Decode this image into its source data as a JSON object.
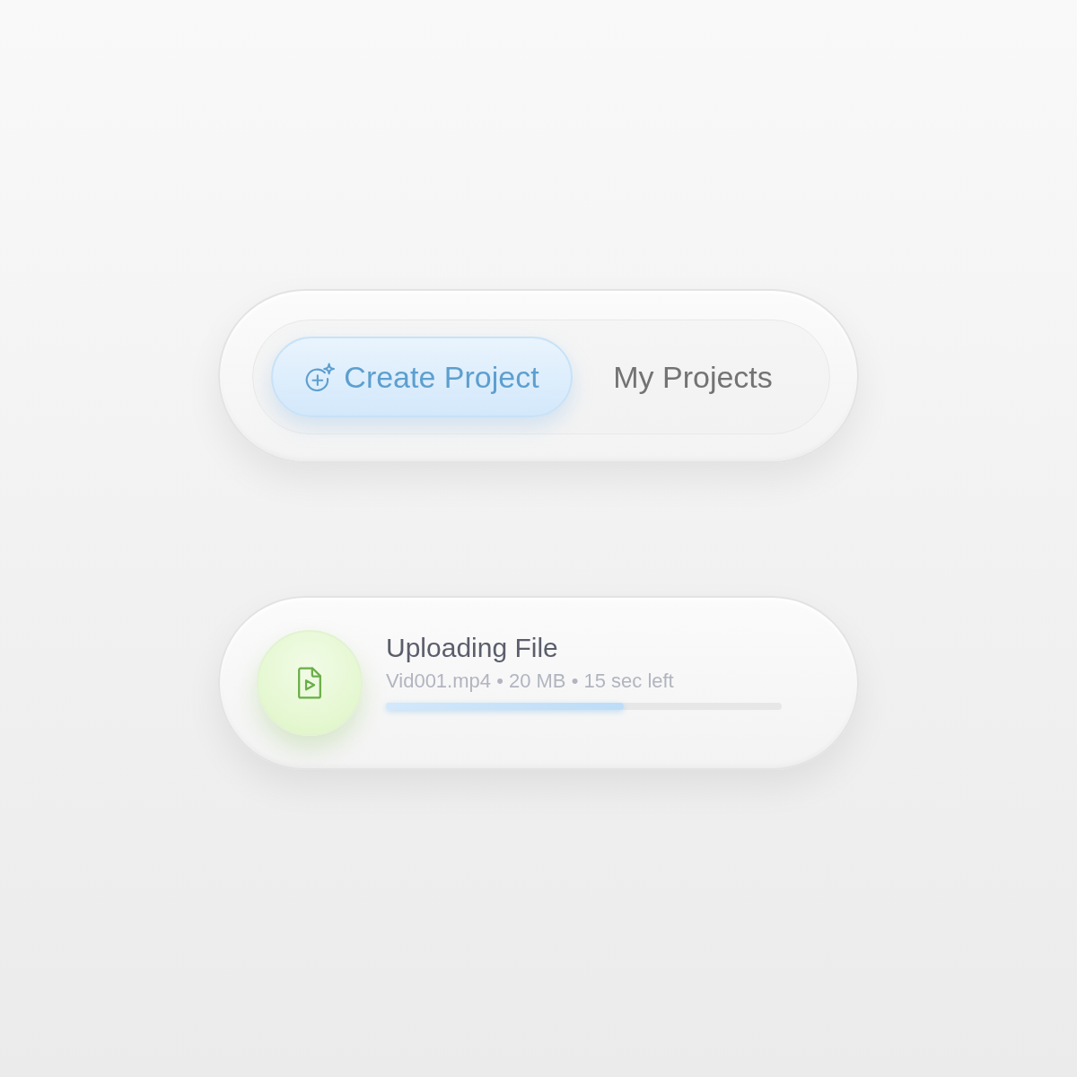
{
  "tabs": [
    {
      "label": "Create Project",
      "selected": true
    },
    {
      "label": "My Projects",
      "selected": false
    }
  ],
  "upload": {
    "title": "Uploading File",
    "details": "Vid001.mp4 • 20 MB • 15 sec left",
    "level": 0.6
  }
}
